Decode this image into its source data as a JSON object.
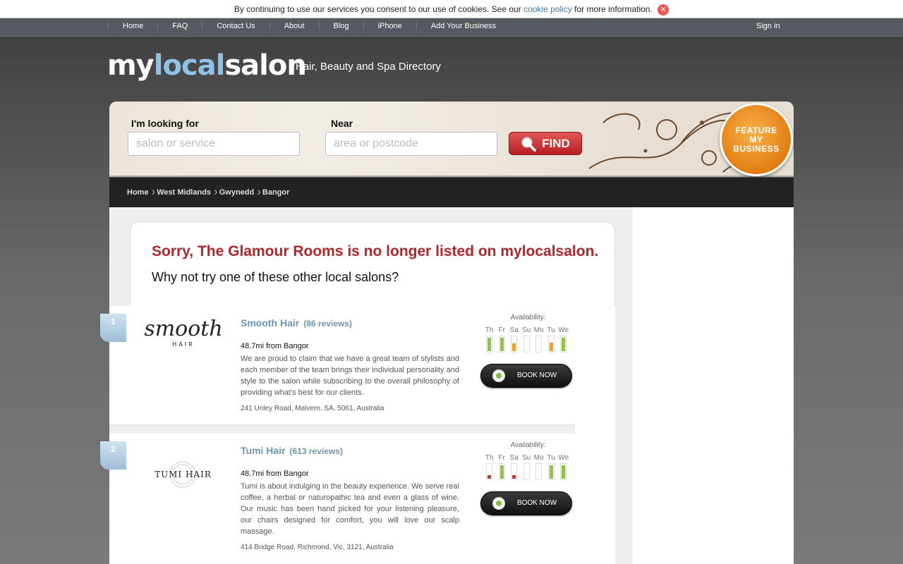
{
  "cookie": {
    "text_before": "By continuing to use our services you consent to our use of cookies. See our",
    "link": "cookie policy",
    "text_after": "for more information.",
    "close_glyph": "✕"
  },
  "nav": {
    "items": [
      "Home",
      "FAQ",
      "Contact Us",
      "About",
      "Blog",
      "iPhone",
      "Add Your Business"
    ],
    "sign_in": "Sign in"
  },
  "brand": {
    "logo_part1": "my",
    "logo_part2": "local",
    "logo_part3": "salon",
    "tagline": "Hair, Beauty and Spa Directory",
    "accent": "#8ec3e6"
  },
  "search": {
    "looking_label": "I'm looking for",
    "looking_placeholder": "salon or service",
    "near_label": "Near",
    "near_placeholder": "area or postcode",
    "find_label": "FIND",
    "feature_line1": "FEATURE",
    "feature_line2": "MY",
    "feature_line3": "BUSINESS"
  },
  "breadcrumb": [
    "Home",
    "West Midlands",
    "Gwynedd",
    "Bangor"
  ],
  "notice": {
    "title": "Sorry, The Glamour Rooms is no longer listed on mylocalsalon.",
    "subtitle": "Why not try one of these other local salons?",
    "title_color": "#b0262a"
  },
  "listings": [
    {
      "rank": "1",
      "logo_text": "smooth",
      "logo_sub": "HAIR",
      "name": "Smooth Hair",
      "reviews": "(86 reviews)",
      "distance": "48.7mi from Bangor",
      "description": "We are proud to claim that we have a great team of stylists and each member of the team brings their individual personality and style to the salon while subscribing to the overall philosophy of providing what’s best for our clients.",
      "address": "241 Unley Road, Malvern, SA, 5061, Australia",
      "availability_label": "Availability:",
      "days": [
        "Th",
        "Fr",
        "Sa",
        "Su",
        "Mo",
        "Tu",
        "We"
      ],
      "availability": [
        0.85,
        0.85,
        0.5,
        0,
        0,
        0.55,
        0.85
      ],
      "availability_colors": [
        "#8cc63f",
        "#8cc63f",
        "#f0a020",
        "#ffffff",
        "#ffffff",
        "#f0a020",
        "#8cc63f"
      ],
      "book_label": "BOOK NOW"
    },
    {
      "rank": "2",
      "logo_text": "TUMI HAIR",
      "logo_sub": "",
      "name": "Tumi Hair",
      "reviews": "(613 reviews)",
      "distance": "48.7mi from Bangor",
      "description": "Tumi is about indulging in the beauty experience. We serve real coffee, a herbal or naturopathic tea and even a glass of wine. Our music has been hand picked for your listening pleasure, our chairs designed for comfort, you will love our scalp massage.",
      "address": "414 Bridge Road, Richmond, Vic, 3121, Australia",
      "availability_label": "Availability:",
      "days": [
        "Th",
        "Fr",
        "Sa",
        "Su",
        "Mo",
        "Tu",
        "We"
      ],
      "availability": [
        0.25,
        0.85,
        0.25,
        0,
        0,
        0.85,
        0.85
      ],
      "availability_colors": [
        "#c0392b",
        "#8cc63f",
        "#c0392b",
        "#ffffff",
        "#ffffff",
        "#8cc63f",
        "#8cc63f"
      ],
      "book_label": "BOOK NOW"
    }
  ]
}
